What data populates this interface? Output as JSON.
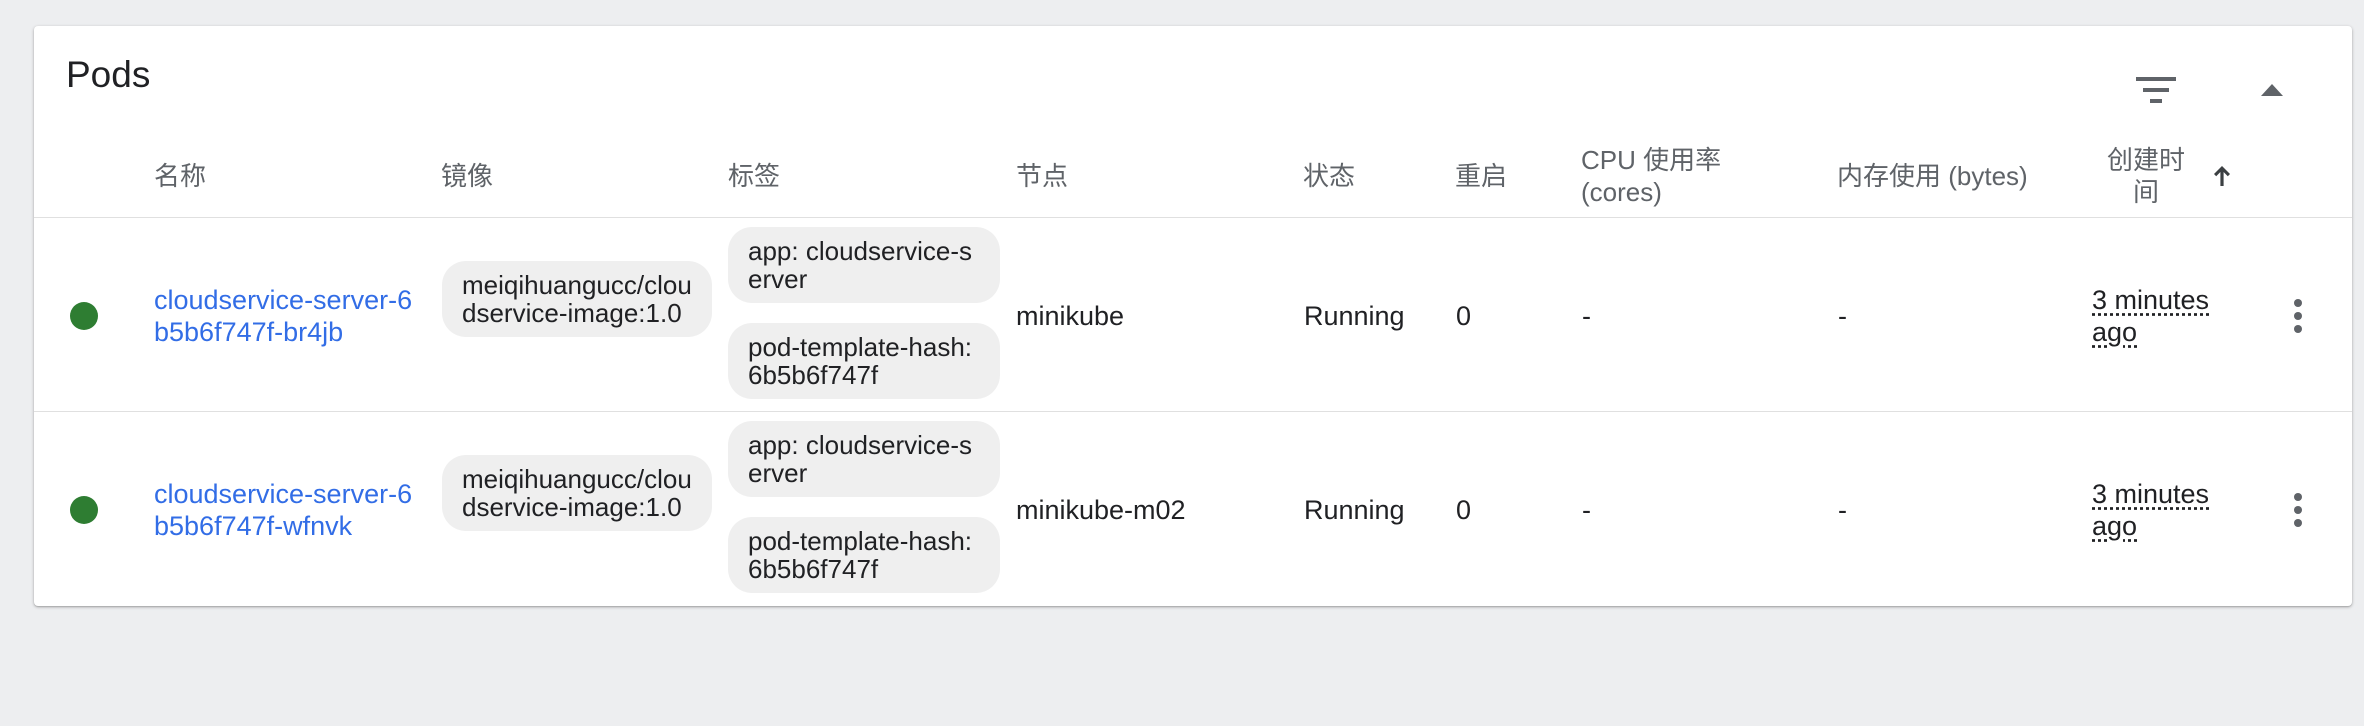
{
  "card": {
    "title": "Pods"
  },
  "columns": {
    "name": "名称",
    "image": "镜像",
    "labels": "标签",
    "node": "节点",
    "status": "状态",
    "restarts": "重启",
    "cpu": "CPU 使用率 (cores)",
    "memory": "内存使用 (bytes)",
    "created": "创建时间"
  },
  "icons": {
    "filter": "filter-icon",
    "collapse": "chevron-up-icon",
    "sort": "arrow-up-icon",
    "status": "status-dot-icon",
    "more": "more-vert-icon"
  },
  "colors": {
    "link": "#326de6",
    "running": "#2e7d32",
    "chip_bg": "#efefef"
  },
  "pods": [
    {
      "name": "cloudservice-server-6b5b6f747f-br4jb",
      "image": "meiqihuangucc/cloudservice-image:1.0",
      "labels": [
        "app: cloudservice-server",
        "pod-template-hash: 6b5b6f747f"
      ],
      "node": "minikube",
      "status": "Running",
      "restarts": "0",
      "cpu": "-",
      "memory": "-",
      "created": "3 minutes ago"
    },
    {
      "name": "cloudservice-server-6b5b6f747f-wfnvk",
      "image": "meiqihuangucc/cloudservice-image:1.0",
      "labels": [
        "app: cloudservice-server",
        "pod-template-hash: 6b5b6f747f"
      ],
      "node": "minikube-m02",
      "status": "Running",
      "restarts": "0",
      "cpu": "-",
      "memory": "-",
      "created": "3 minutes ago"
    }
  ]
}
